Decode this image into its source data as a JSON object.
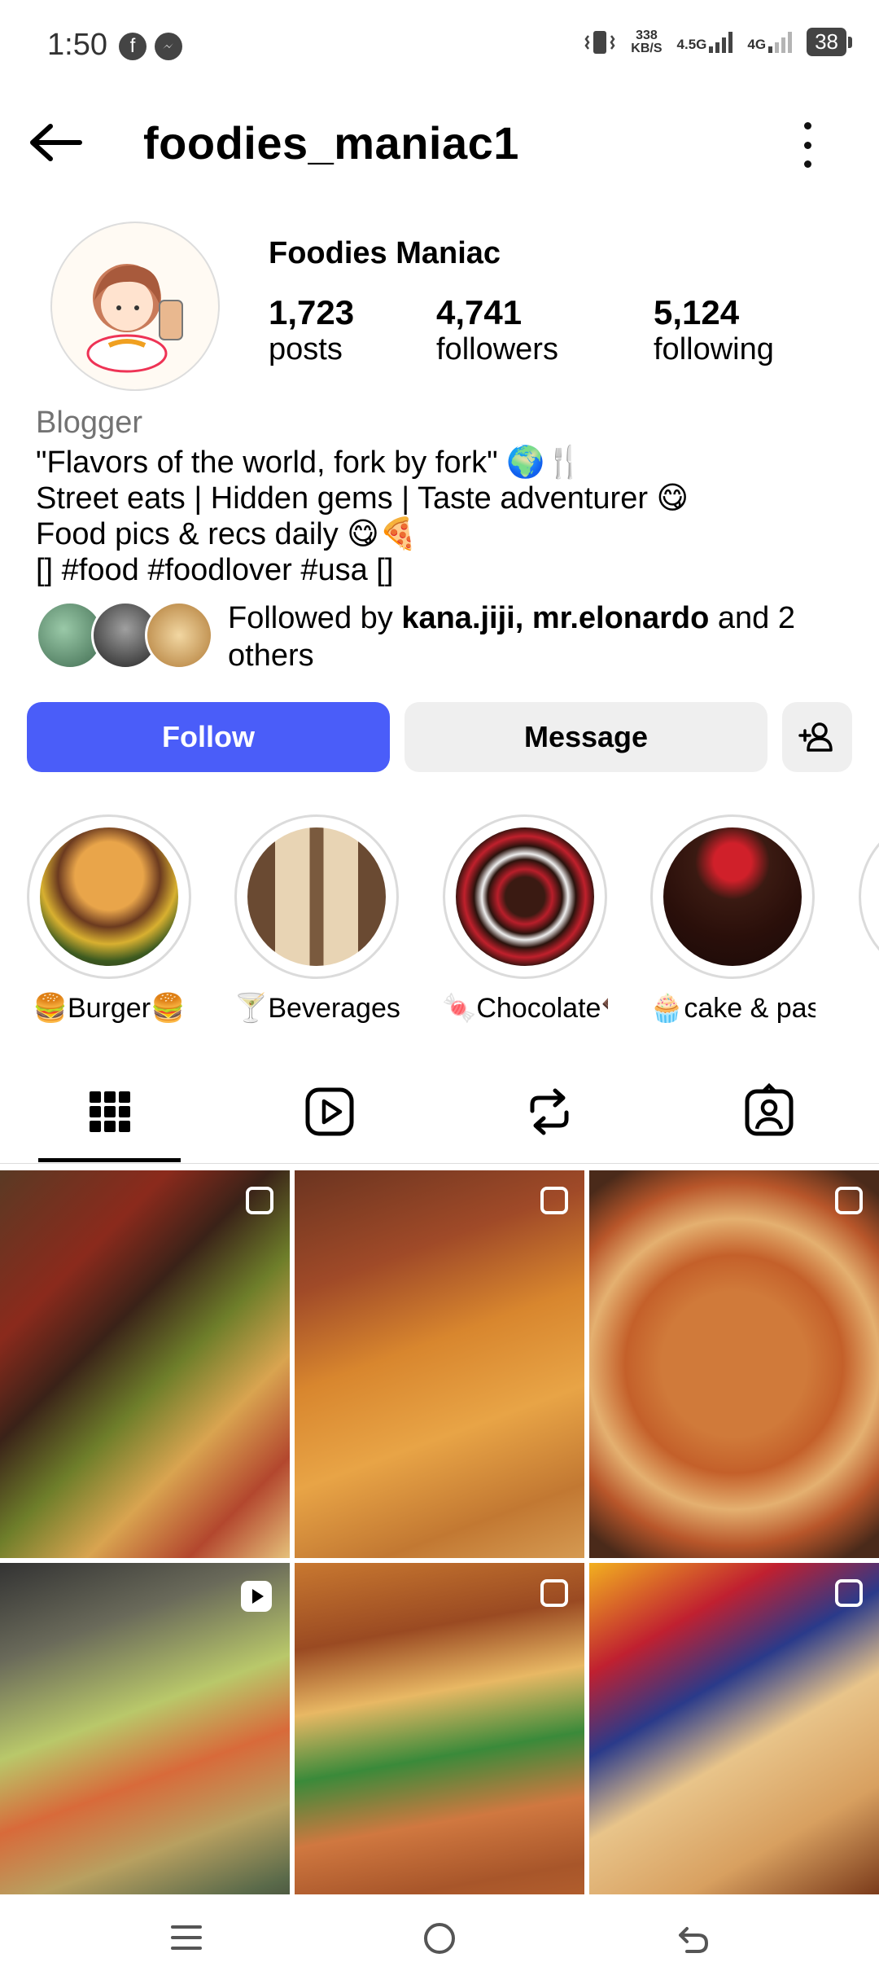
{
  "status_bar": {
    "time": "1:50",
    "net_speed_value": "338",
    "net_speed_unit": "KB/S",
    "sig1": "4.5G",
    "sig2": "4G",
    "battery": "38"
  },
  "header": {
    "username": "foodies_maniac1"
  },
  "profile": {
    "display_name": "Foodies Maniac",
    "stats": [
      {
        "value": "1,723",
        "label": "posts"
      },
      {
        "value": "4,741",
        "label": "followers"
      },
      {
        "value": "5,124",
        "label": "following"
      }
    ],
    "category": "Blogger",
    "bio_lines": [
      "\"Flavors of the world, fork by fork\" 🌍🍴",
      "Street eats | Hidden gems | Taste adventurer 😋",
      "Food pics & recs daily 😋🍕",
      "[] #food #foodlover #usa []"
    ],
    "followed_by_prefix": "Followed by ",
    "followed_by_names": "kana.jiji, mr.elonardo",
    "followed_by_suffix": " and 2",
    "followed_by_line2": "others"
  },
  "actions": {
    "follow_label": "Follow",
    "message_label": "Message"
  },
  "highlights": [
    {
      "label": "🍔Burger🍔"
    },
    {
      "label": "🍸Beverages..."
    },
    {
      "label": "🍬Chocolate🍫"
    },
    {
      "label": "🧁cake & past..."
    }
  ],
  "tabs": [
    "grid-tab",
    "reels-tab",
    "reposts-tab",
    "tagged-tab"
  ],
  "colors": {
    "follow_button": "#4a5df9",
    "secondary_button": "#efefef"
  }
}
